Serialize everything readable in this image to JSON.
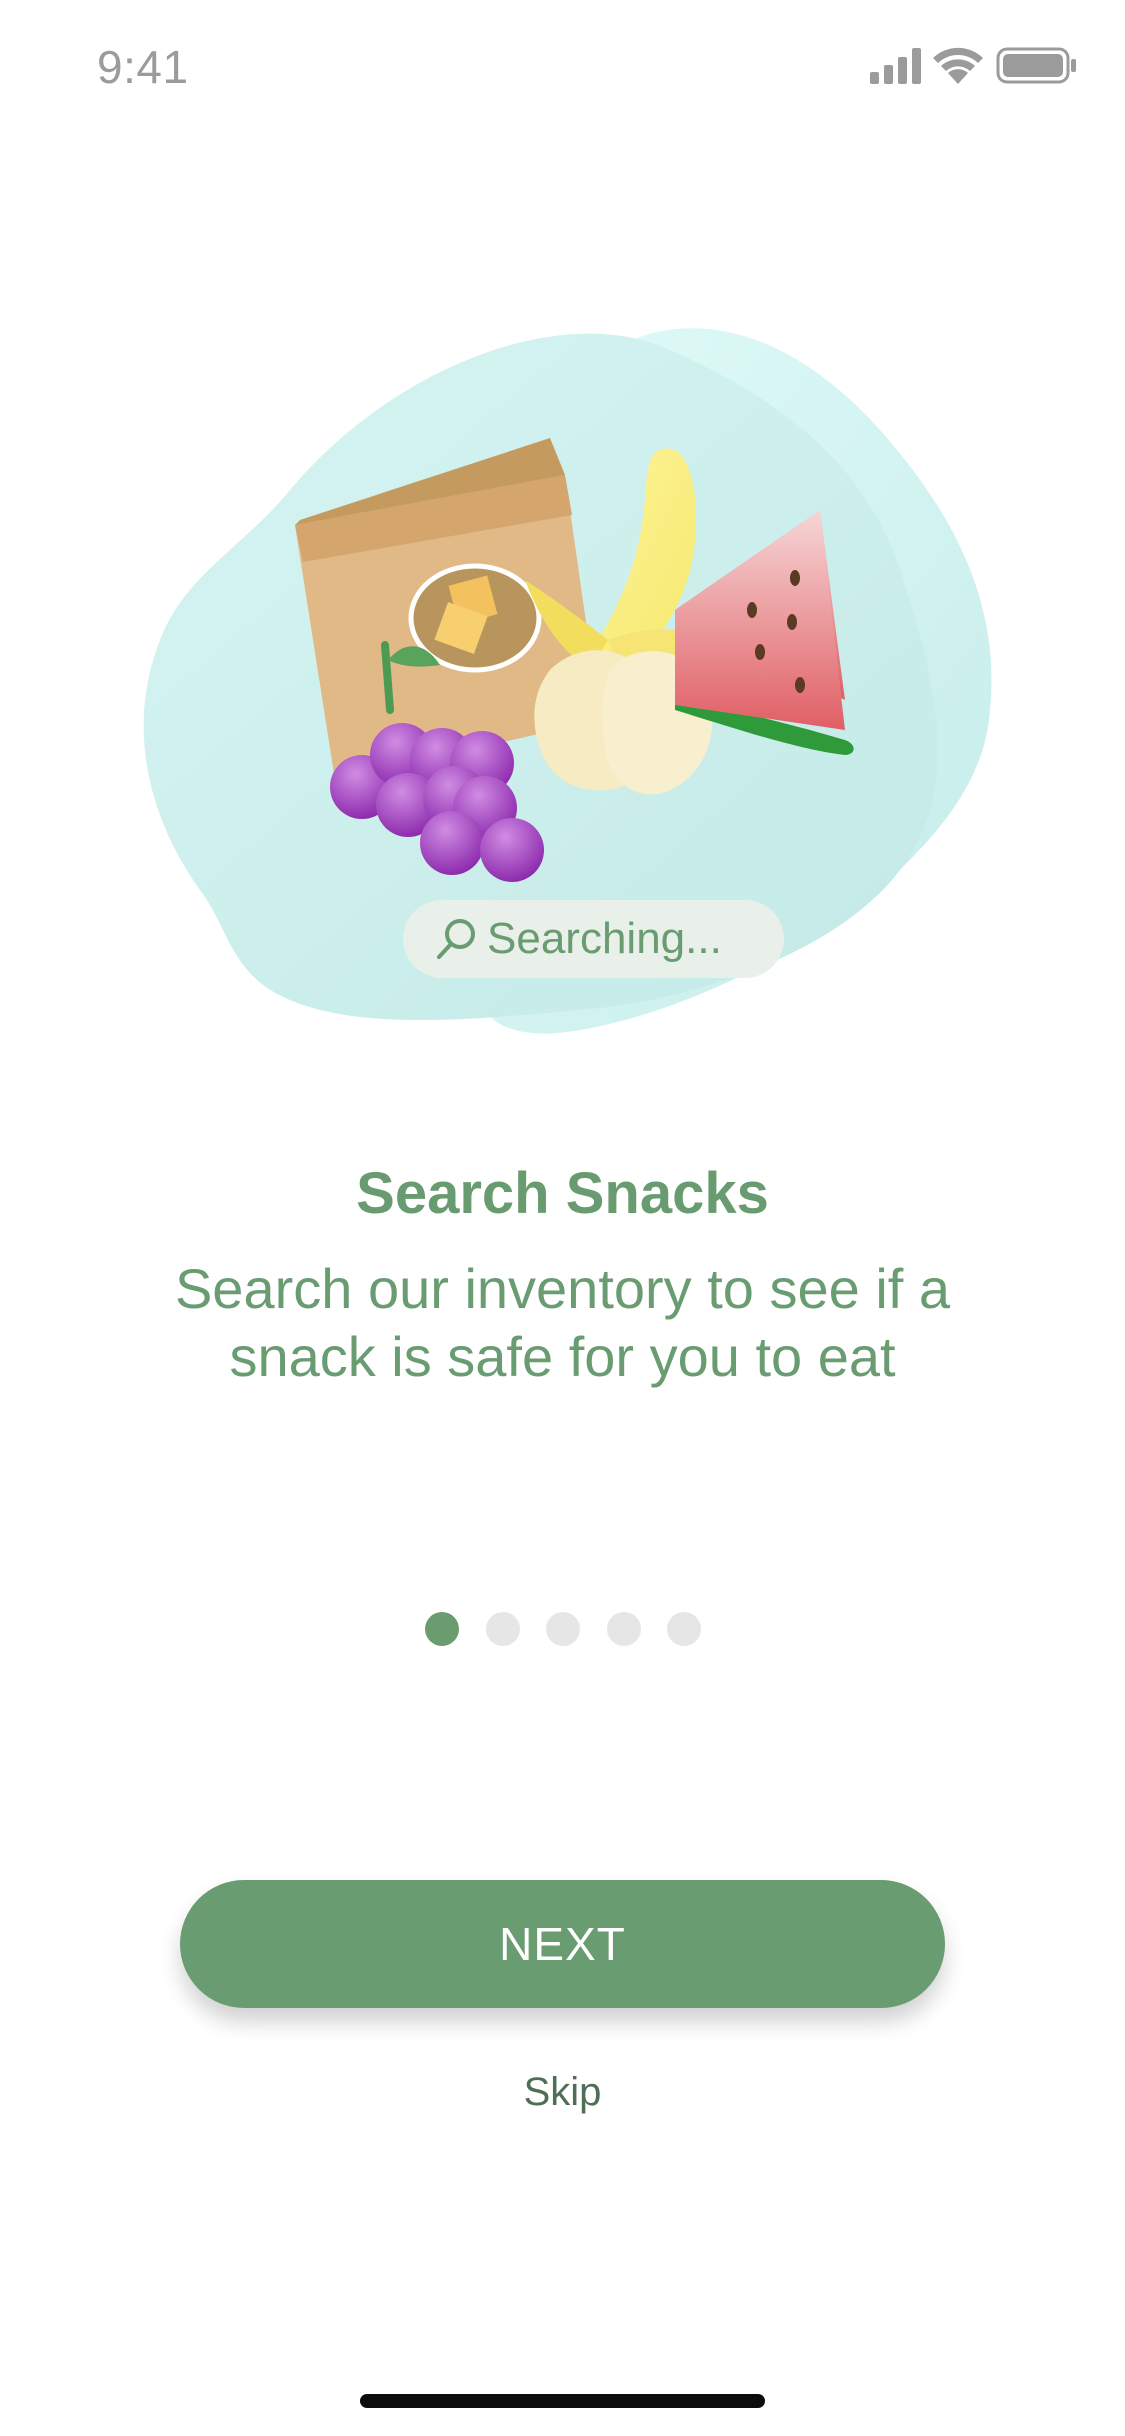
{
  "status_bar": {
    "time": "9:41"
  },
  "illustration": {
    "search_pill": {
      "icon": "search-icon",
      "label": "Searching..."
    }
  },
  "onboarding": {
    "title": "Search Snacks",
    "subtitle": "Search our inventory to see if a snack is safe for you to eat",
    "page_index": 1,
    "page_count": 5
  },
  "actions": {
    "next_label": "NEXT",
    "skip_label": "Skip"
  },
  "colors": {
    "accent_green": "#699c70",
    "title_green": "#689c70",
    "inactive_dot": "#e6e6e6",
    "blob_mint": "#cdeeec"
  }
}
